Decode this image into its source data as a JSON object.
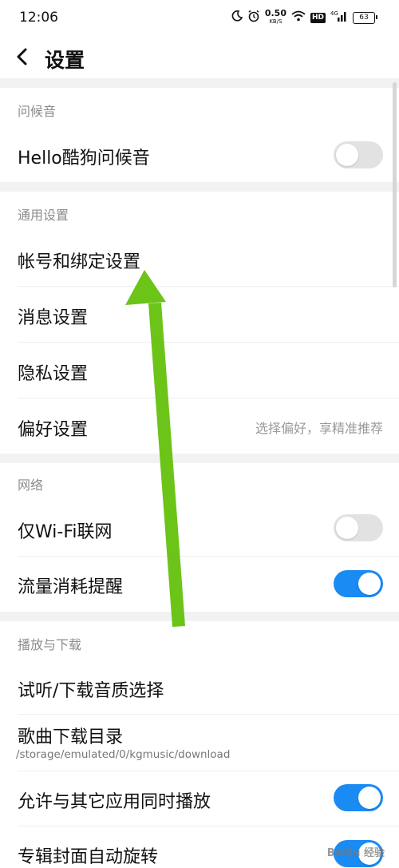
{
  "status_bar": {
    "time": "12:06",
    "net_speed_value": "0.50",
    "net_speed_unit": "KB/S",
    "hd_label": "HD",
    "signal_label": "4G",
    "battery_level": "63"
  },
  "header": {
    "title": "设置"
  },
  "sections": {
    "greeting": {
      "title": "问候音",
      "items": [
        {
          "label": "Hello酷狗问候音",
          "toggle_on": false
        }
      ]
    },
    "general": {
      "title": "通用设置",
      "items": [
        {
          "label": "帐号和绑定设置"
        },
        {
          "label": "消息设置"
        },
        {
          "label": "隐私设置"
        },
        {
          "label": "偏好设置",
          "hint": "选择偏好，享精准推荐"
        }
      ]
    },
    "network": {
      "title": "网络",
      "items": [
        {
          "label": "仅Wi-Fi联网",
          "toggle_on": false
        },
        {
          "label": "流量消耗提醒",
          "toggle_on": true
        }
      ]
    },
    "playback": {
      "title": "播放与下载",
      "items": [
        {
          "label": "试听/下载音质选择"
        },
        {
          "label": "歌曲下载目录",
          "sub": "/storage/emulated/0/kgmusic/download"
        },
        {
          "label": "允许与其它应用同时播放",
          "toggle_on": true
        },
        {
          "label": "专辑封面自动旋转",
          "toggle_on": true
        }
      ]
    }
  },
  "watermark": "Baidu 经验",
  "colors": {
    "accent": "#1a8bf2",
    "arrow": "#6cc419",
    "section_bg": "#f2f2f2"
  }
}
